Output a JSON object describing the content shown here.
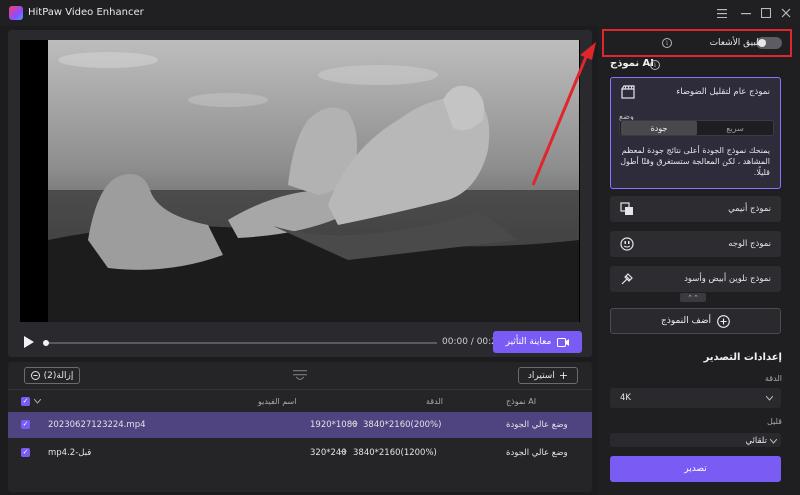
{
  "app": {
    "title": "HitPaw Video Enhancer"
  },
  "player": {
    "time": "00:00 / 00:25",
    "preview_label": "معاينة التأثير",
    "progress": 0
  },
  "filelist": {
    "remove_label": "إزالة(2)",
    "import_label": "استيراد",
    "headers": {
      "name": "اسم الفيديو",
      "resolution": "الدقة",
      "model": "نموذج AI"
    },
    "rows": [
      {
        "name": "20230627123224.mp4",
        "source": "1920*1080",
        "target": "3840*2160(200%)",
        "model": "وضع عالي الجودة",
        "selected": true
      },
      {
        "name": "mp4.2-قبل",
        "source": "320*240",
        "target": "3840*2160(1200%)",
        "model": "وضع عالي الجودة",
        "selected": false
      }
    ]
  },
  "panel": {
    "denoise_label": "تطبيق الأشعات",
    "denoise_on": false,
    "model_section": "نموذج AI",
    "general_model": {
      "name": "نموذج عام لتقليل الضوضاء",
      "mode_label": "وضع",
      "modes": [
        "جودة",
        "سريع"
      ],
      "selected_mode": "جودة",
      "description": "يمنحك نموذج الجودة أعلى نتائج جودة لمعظم المشاهد ، لكن المعالجة ستستغرق وقتًا أطول قليلًا."
    },
    "models": [
      {
        "name": "نموذج أنيمي",
        "icon": "anime-icon"
      },
      {
        "name": "نموذج الوجه",
        "icon": "face-icon"
      },
      {
        "name": "نموذج تلوين أبيض وأسود",
        "icon": "colorize-icon"
      }
    ],
    "add_model": "أضف النموذج",
    "export_section": "إعدادات التصدير",
    "resolution_label": "الدقة",
    "resolution_value": "4K",
    "format_label": "قليل",
    "format_value": "تلقائي",
    "export_label": "تصدير"
  },
  "colors": {
    "accent": "#7a5cf5",
    "highlight": "#e0262d"
  }
}
